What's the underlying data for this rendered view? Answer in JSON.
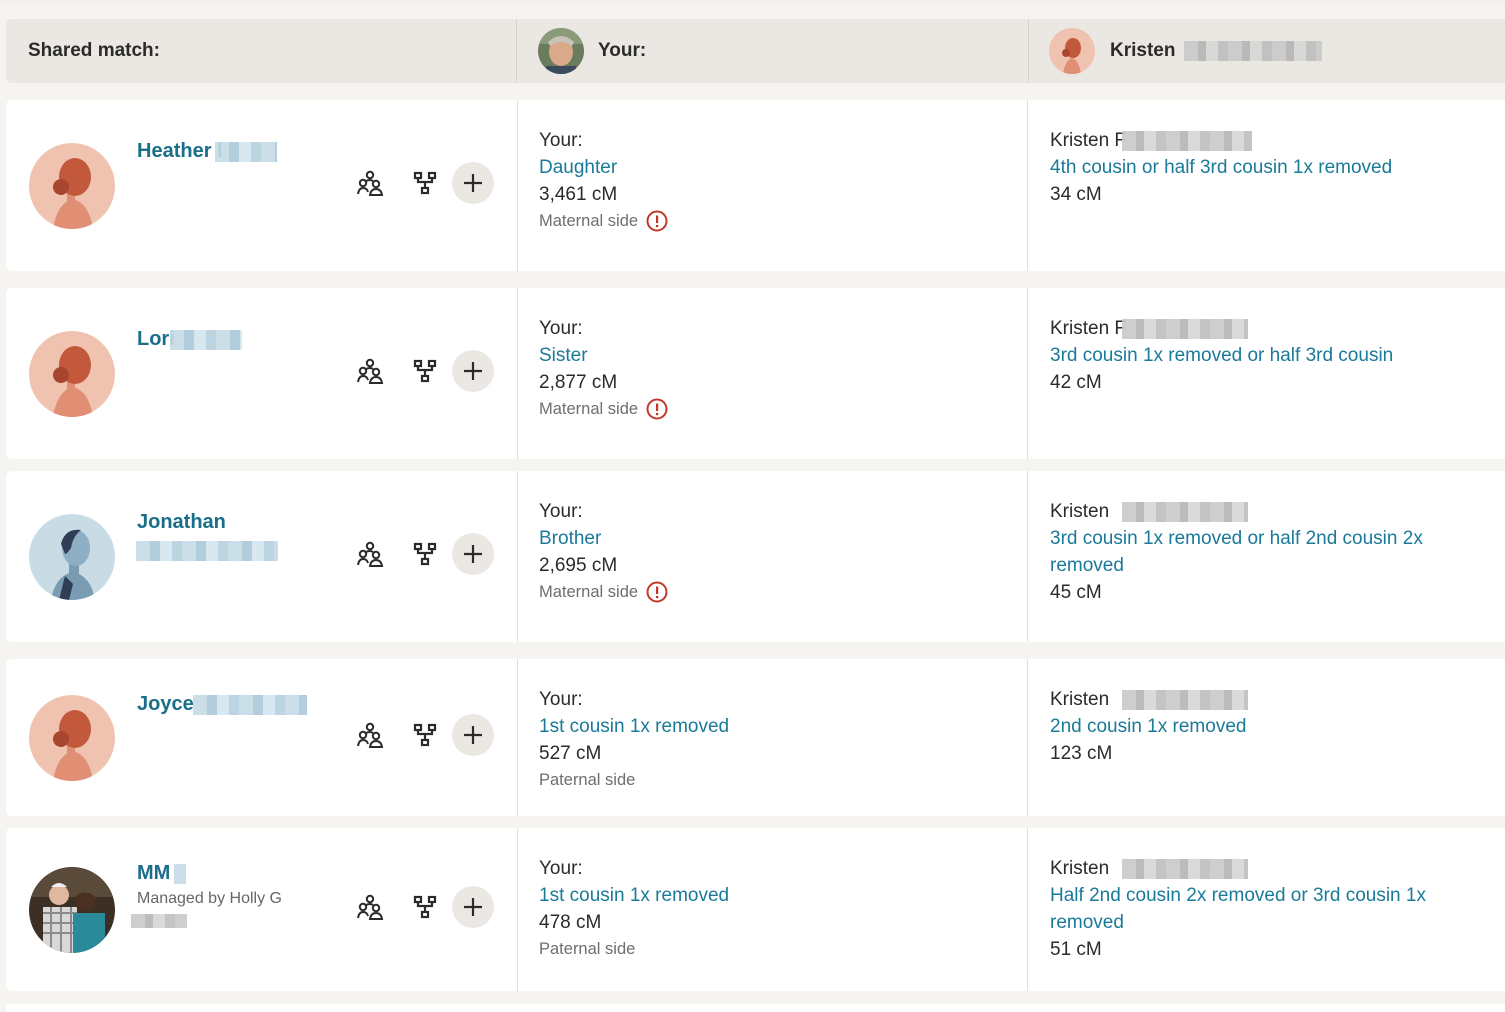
{
  "header": {
    "shared_match_label": "Shared match:",
    "your_label": "Your:",
    "other_name": "Kristen"
  },
  "matches": [
    {
      "name": "Heather I",
      "avatar": "female-silhouette",
      "your_label": "Your:",
      "your_relationship": "Daughter",
      "your_cm": "3,461 cM",
      "your_side": "Maternal side",
      "side_alert": true,
      "other_label": "Kristen F",
      "other_relationship": "4th cousin or half 3rd cousin 1x removed",
      "other_cm": "34 cM"
    },
    {
      "name": "Lori",
      "avatar": "female-silhouette",
      "your_label": "Your:",
      "your_relationship": "Sister",
      "your_cm": "2,877 cM",
      "your_side": "Maternal side",
      "side_alert": true,
      "other_label": "Kristen F",
      "other_relationship": "3rd cousin 1x removed or half 3rd cousin",
      "other_cm": "42 cM"
    },
    {
      "name": "Jonathan",
      "avatar": "male-silhouette",
      "your_label": "Your:",
      "your_relationship": "Brother",
      "your_cm": "2,695 cM",
      "your_side": "Maternal side",
      "side_alert": true,
      "other_label": "Kristen",
      "other_relationship": "3rd cousin 1x removed or half 2nd cousin 2x removed",
      "other_cm": "45 cM"
    },
    {
      "name": "Joyce",
      "avatar": "female-silhouette",
      "your_label": "Your:",
      "your_relationship": "1st cousin 1x removed",
      "your_cm": "527 cM",
      "your_side": "Paternal side",
      "side_alert": false,
      "other_label": "Kristen",
      "other_relationship": "2nd cousin 1x removed",
      "other_cm": "123 cM"
    },
    {
      "name": "MM",
      "managed_by": "Managed by Holly G",
      "avatar": "photo",
      "your_label": "Your:",
      "your_relationship": "1st cousin 1x removed",
      "your_cm": "478 cM",
      "your_side": "Paternal side",
      "side_alert": false,
      "other_label": "Kristen",
      "other_relationship": "Half 2nd cousin 2x removed or 3rd cousin 1x removed",
      "other_cm": "51 cM"
    }
  ],
  "icons": {
    "shared_matches": "people-group-icon",
    "tree": "family-tree-icon",
    "add": "plus-icon",
    "alert": "exclamation-circle-icon"
  },
  "colors": {
    "link": "#1a7a99",
    "alert": "#c0392b",
    "header_bg": "#ebe7e2"
  }
}
